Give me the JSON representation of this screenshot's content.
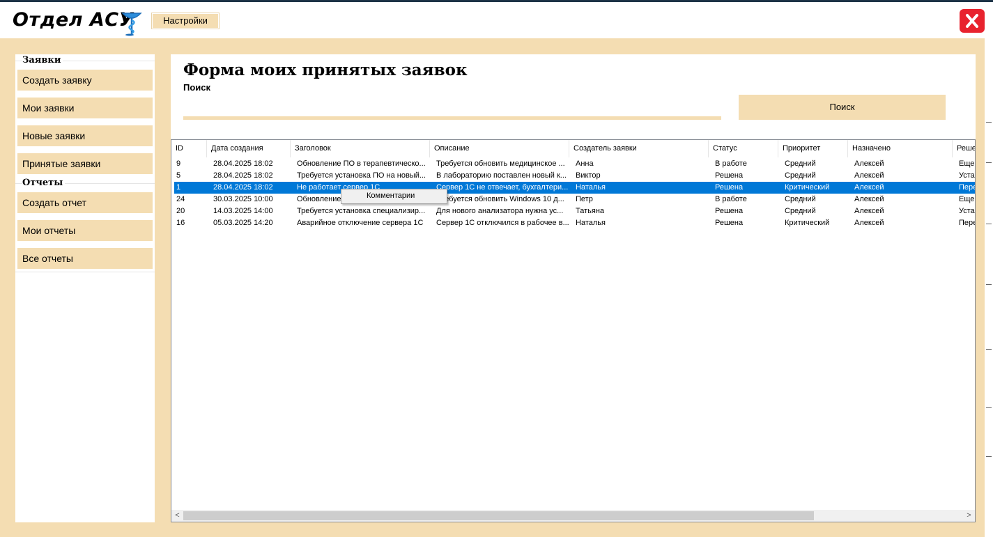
{
  "app": {
    "title": "Отдел АСУ",
    "settings_label": "Настройки",
    "close_icon": "close-icon"
  },
  "sidebar": {
    "groups": [
      {
        "title": "Заявки",
        "items": [
          "Создать заявку",
          "Мои заявки",
          "Новые заявки",
          "Принятые заявки"
        ]
      },
      {
        "title": "Отчеты",
        "items": [
          "Создать отчет",
          "Мои отчеты",
          "Все отчеты"
        ]
      }
    ]
  },
  "main": {
    "title": "Форма моих принятых заявок",
    "search_label": "Поиск",
    "search_value": "",
    "search_button": "Поиск"
  },
  "grid": {
    "columns": [
      "ID",
      "Дата создания",
      "Заголовок",
      "Описание",
      "Создатель заявки",
      "Статус",
      "Приоритет",
      "Назначено",
      "Реше"
    ],
    "rows": [
      [
        "9",
        "28.04.2025 18:02",
        "Обновление ПО в терапевтическо...",
        "Требуется обновить медицинское ...",
        "Анна",
        "В работе",
        "Средний",
        "Алексей",
        "Еще"
      ],
      [
        "5",
        "28.04.2025 18:02",
        "Требуется установка ПО на новый...",
        "В лабораторию поставлен новый к...",
        "Виктор",
        "Решена",
        "Средний",
        "Алексей",
        "Уста"
      ],
      [
        "1",
        "28.04.2025 18:02",
        "Не работает сервер 1С",
        "Сервер 1С не отвечает, бухгалтери...",
        "Наталья",
        "Решена",
        "Критический",
        "Алексей",
        "Пере"
      ],
      [
        "24",
        "30.03.2025 10:00",
        "Обновление ОС",
        "Требуется обновить Windows 10 д...",
        "Петр",
        "В работе",
        "Средний",
        "Алексей",
        "Еще"
      ],
      [
        "20",
        "14.03.2025 14:00",
        "Требуется установка специализир...",
        "Для нового анализатора нужна ус...",
        "Татьяна",
        "Решена",
        "Средний",
        "Алексей",
        "Уста"
      ],
      [
        "16",
        "05.03.2025 14:20",
        "Аварийное отключение сервера 1С",
        "Сервер 1С отключился в рабочее в...",
        "Наталья",
        "Решена",
        "Критический",
        "Алексей",
        "Пере"
      ]
    ],
    "selected_row": 2,
    "context_menu": [
      "Комментарии"
    ]
  },
  "colors": {
    "background": "#f4ddb2",
    "accent": "#f4ddb2",
    "selection": "#0078d7",
    "close": "#e8232e"
  }
}
